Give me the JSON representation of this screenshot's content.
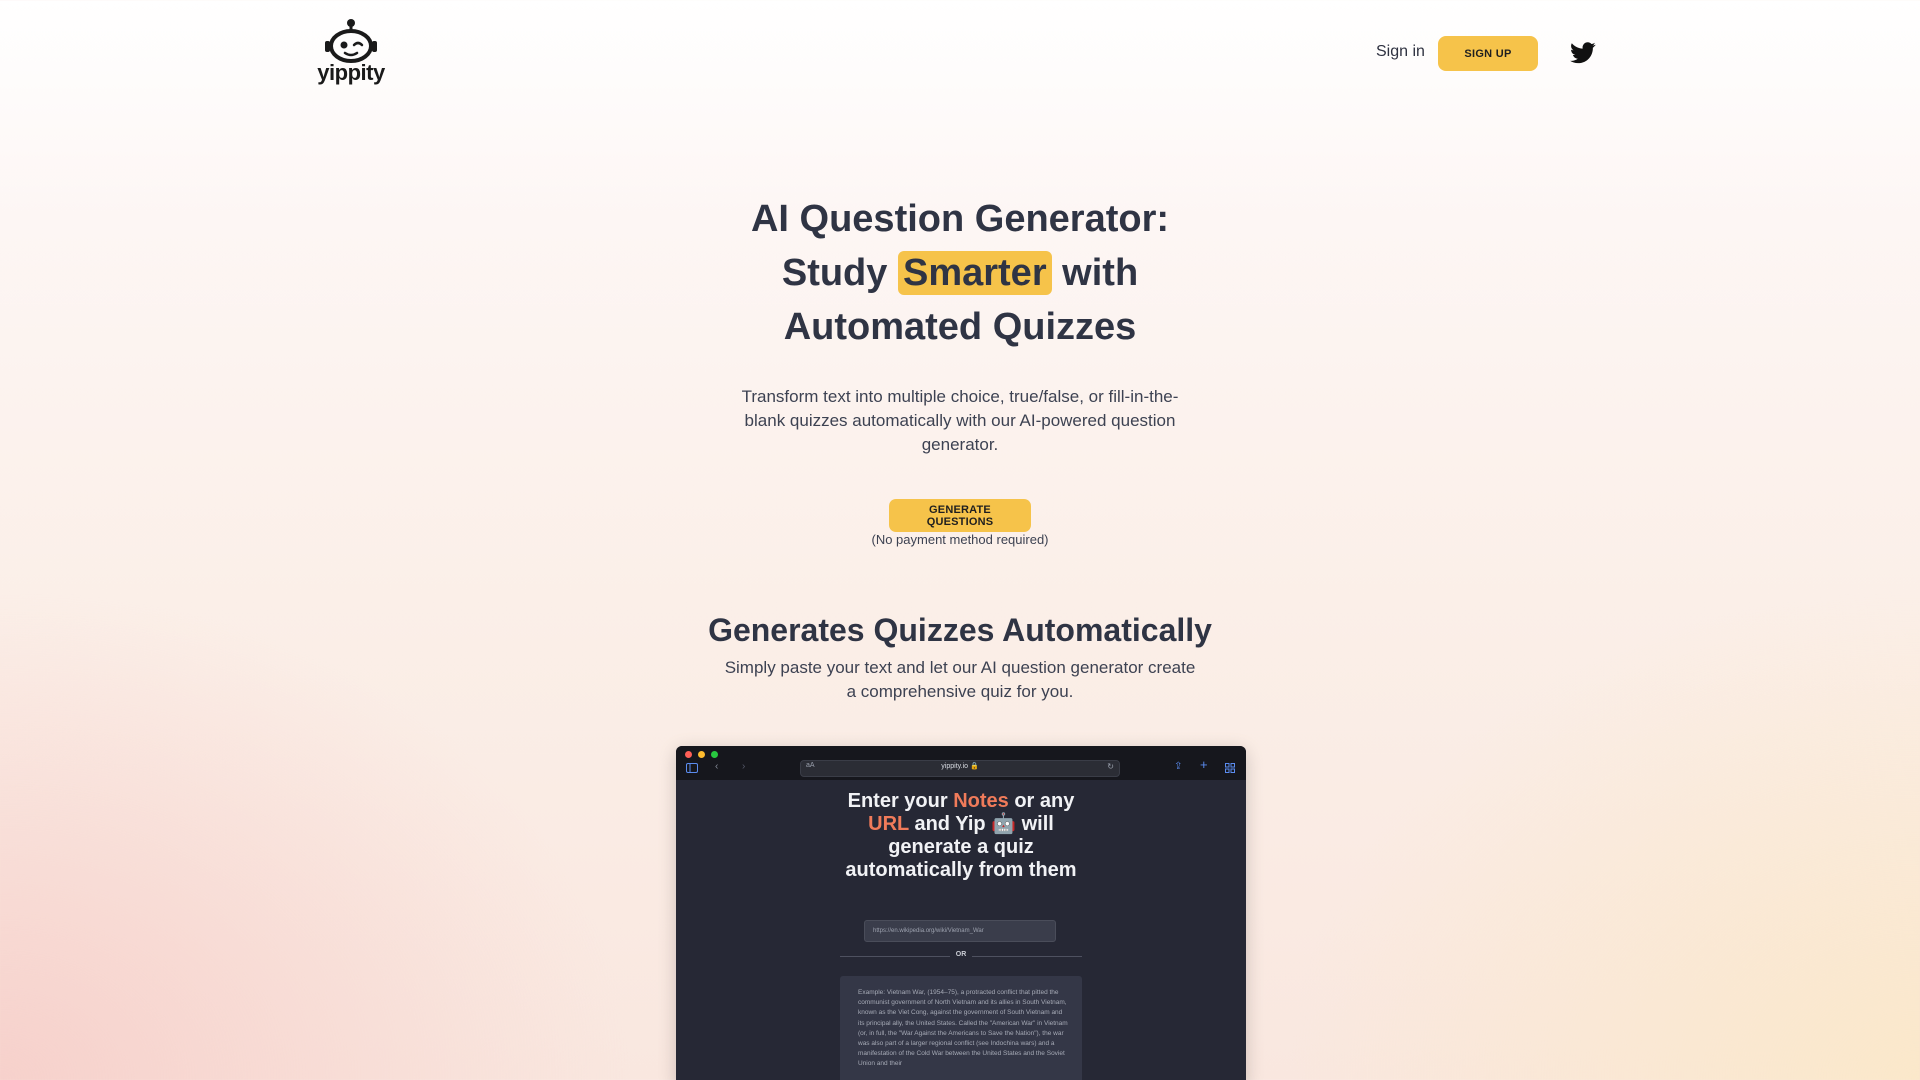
{
  "header": {
    "logo_text": "yippity",
    "signin_label": "Sign in",
    "signup_label": "SIGN UP"
  },
  "hero": {
    "title_line1": "AI Question Generator:",
    "title_study": "Study",
    "title_highlight": "Smarter",
    "title_with": "with",
    "title_line3": "Automated Quizzes",
    "subtitle": "Transform text into multiple choice, true/false, or fill-in-the-blank quizzes automatically with our AI-powered question generator.",
    "cta_label": "GENERATE QUESTIONS",
    "cta_note": "(No payment method required)"
  },
  "section": {
    "title": "Generates Quizzes Automatically",
    "subtitle": "Simply paste your text and let our AI question generator create a comprehensive quiz for you."
  },
  "mockup": {
    "url_prefix": "aA",
    "url": "yippity.io 🔒",
    "title_p1": "Enter your",
    "title_notes": "Notes",
    "title_p2": "or any",
    "title_url": "URL",
    "title_p3": "and Yip 🤖 will generate a quiz automatically from them",
    "url_input_value": "https://en.wikipedia.org/wiki/Vietnam_War",
    "or_label": "OR",
    "notes_text": "Example: Vietnam War, (1954–75), a protracted conflict that pitted the communist government of North Vietnam and its allies in South Vietnam, known as the Viet Cong, against the government of South Vietnam and its principal ally, the United States. Called the \"American War\" in Vietnam (or, in full, the \"War Against the Americans to Save the Nation\"), the war was also part of a larger regional conflict (see Indochina wars) and a manifestation of the Cold War between the United States and the Soviet Union and their"
  },
  "colors": {
    "accent_yellow": "#f6c34a",
    "heading_text": "#2f3444",
    "mock_accent": "#f07b5a",
    "mock_bg": "#262835"
  },
  "icons": [
    "robot-logo-icon",
    "twitter-icon",
    "sidebar-icon",
    "back-icon",
    "forward-icon",
    "reload-icon",
    "share-icon",
    "new-tab-icon",
    "tabs-grid-icon"
  ]
}
